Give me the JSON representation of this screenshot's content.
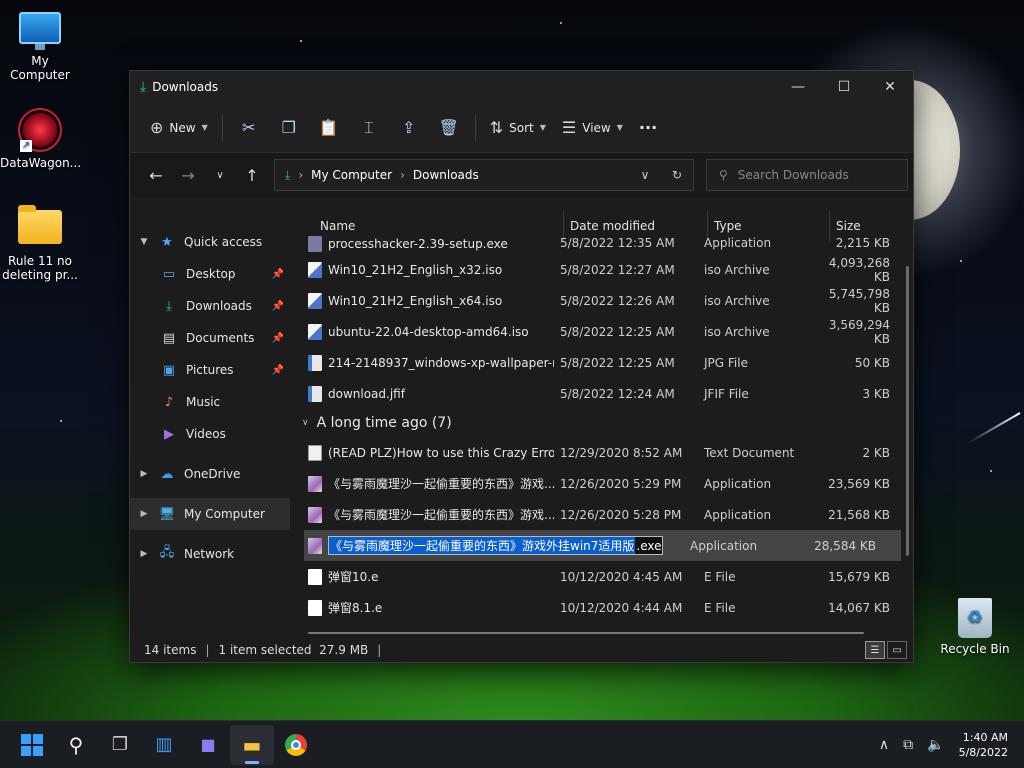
{
  "desktop": {
    "icons": [
      {
        "label": "My Computer"
      },
      {
        "label": "DataWagon..."
      },
      {
        "label": "Rule 11 no deleting pr..."
      },
      {
        "label": "Recycle Bin"
      }
    ]
  },
  "window": {
    "title": "Downloads",
    "controls": {
      "minimize": "—",
      "maximize": "☐",
      "close": "✕"
    }
  },
  "commandbar": {
    "new_label": "New",
    "sort_label": "Sort",
    "view_label": "View",
    "more_label": "···"
  },
  "address": {
    "crumbs": [
      "My Computer",
      "Downloads"
    ],
    "search_placeholder": "Search Downloads"
  },
  "navpane": {
    "quick_access": "Quick access",
    "items": [
      {
        "label": "Desktop",
        "icon": "desktop-icon"
      },
      {
        "label": "Downloads",
        "icon": "download-icon"
      },
      {
        "label": "Documents",
        "icon": "documents-icon"
      },
      {
        "label": "Pictures",
        "icon": "pictures-icon"
      },
      {
        "label": "Music",
        "icon": "music-icon"
      },
      {
        "label": "Videos",
        "icon": "videos-icon"
      }
    ],
    "onedrive": "OneDrive",
    "mycomputer": "My Computer",
    "network": "Network"
  },
  "columns": {
    "name": "Name",
    "date": "Date modified",
    "type": "Type",
    "size": "Size"
  },
  "files_recent": [
    {
      "name": "processhacker-2.39-setup.exe",
      "date": "5/8/2022 12:35 AM",
      "type": "Application",
      "size": "2,215 KB"
    },
    {
      "name": "Win10_21H2_English_x32.iso",
      "date": "5/8/2022 12:27 AM",
      "type": "iso Archive",
      "size": "4,093,268 KB"
    },
    {
      "name": "Win10_21H2_English_x64.iso",
      "date": "5/8/2022 12:26 AM",
      "type": "iso Archive",
      "size": "5,745,798 KB"
    },
    {
      "name": "ubuntu-22.04-desktop-amd64.iso",
      "date": "5/8/2022 12:25 AM",
      "type": "iso Archive",
      "size": "3,569,294 KB"
    },
    {
      "name": "214-2148937_windows-xp-wallpaper-nig...",
      "date": "5/8/2022 12:25 AM",
      "type": "JPG File",
      "size": "50 KB"
    },
    {
      "name": "download.jfif",
      "date": "5/8/2022 12:24 AM",
      "type": "JFIF File",
      "size": "3 KB"
    }
  ],
  "group_old": "A long time ago (7)",
  "files_old": [
    {
      "name": "(READ PLZ)How to use this Crazy Error pr...",
      "date": "12/29/2020 8:52 AM",
      "type": "Text Document",
      "size": "2 KB"
    },
    {
      "name": "《与雾雨魔理沙一起偷重要的东西》游戏...",
      "date": "12/26/2020 5:29 PM",
      "type": "Application",
      "size": "23,569 KB"
    },
    {
      "name": "《与雾雨魔理沙一起偷重要的东西》游戏...",
      "date": "12/26/2020 5:28 PM",
      "type": "Application",
      "size": "21,568 KB"
    }
  ],
  "renaming": {
    "selected_text": "《与雾雨魔理沙一起偷重要的东西》游戏外挂win7适用版",
    "extension": ".exe",
    "type": "Application",
    "size": "28,584 KB"
  },
  "files_old_tail": [
    {
      "name": "弹窗10.e",
      "date": "10/12/2020 4:45 AM",
      "type": "E File",
      "size": "15,679 KB"
    },
    {
      "name": "弹窗8.1.e",
      "date": "10/12/2020 4:44 AM",
      "type": "E File",
      "size": "14,067 KB"
    }
  ],
  "status": {
    "items": "14 items",
    "selected": "1 item selected  27.9 MB"
  },
  "taskbar": {
    "time": "1:40 AM",
    "date": "5/8/2022"
  }
}
